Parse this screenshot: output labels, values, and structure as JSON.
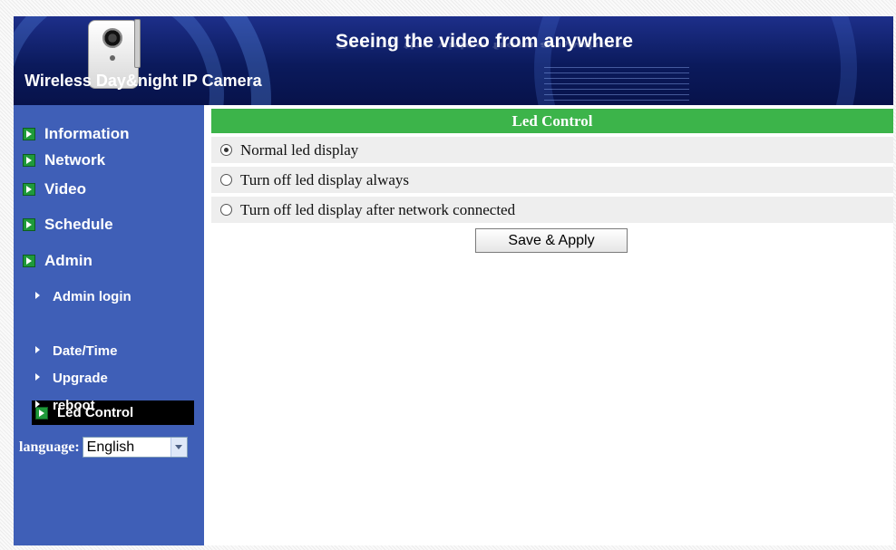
{
  "header": {
    "slogan": "Seeing the video from anywhere",
    "product_name": "Wireless Day&night IP Camera"
  },
  "sidebar": {
    "items": [
      {
        "label": "Information"
      },
      {
        "label": "Network"
      },
      {
        "label": "Video"
      },
      {
        "label": "Schedule"
      },
      {
        "label": "Admin"
      }
    ],
    "admin_sub": [
      {
        "label": "Admin login"
      },
      {
        "label": "Led Control"
      },
      {
        "label": "Date/Time"
      },
      {
        "label": "Upgrade"
      },
      {
        "label": "reboot"
      }
    ],
    "language": {
      "label": "language:",
      "selected": "English"
    }
  },
  "main": {
    "section_title": "Led Control",
    "options": [
      {
        "label": "Normal led display",
        "checked": true
      },
      {
        "label": "Turn off led display always",
        "checked": false
      },
      {
        "label": "Turn off led display after network connected",
        "checked": false
      }
    ],
    "save_button": "Save & Apply"
  },
  "colors": {
    "sidebar_bg": "#3f5fb7",
    "header_green": "#3cb44a",
    "active_item_bg": "#000000"
  }
}
